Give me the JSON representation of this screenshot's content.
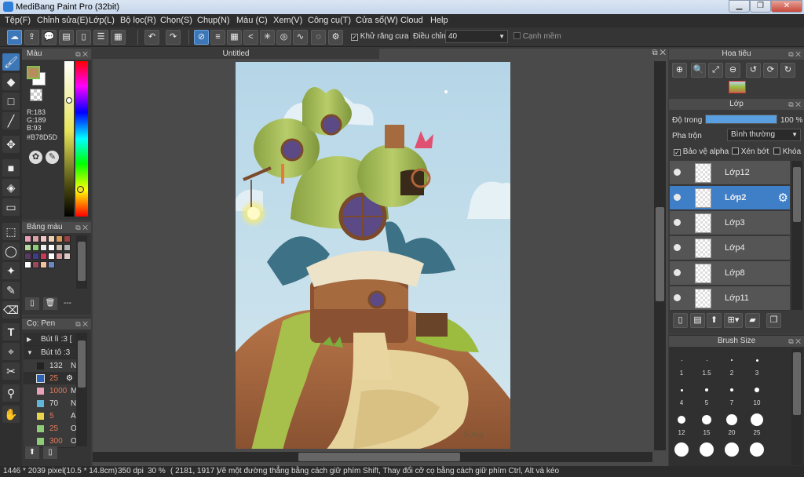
{
  "window": {
    "title": "MediBang Paint Pro (32bit)",
    "controls": [
      "▁",
      "❐",
      "✕"
    ]
  },
  "menu": [
    "Tệp(F)",
    "Chỉnh sửa(E)",
    "Lớp(L)",
    "Bộ lọc(R)",
    "Chọn(S)",
    "Chụp(N)",
    "Màu (C)",
    "Xem(V)",
    "Công cụ(T)",
    "Cửa sổ(W)",
    "Cloud",
    "Help"
  ],
  "toolbar": {
    "antialias_label": "Khử răng cưa",
    "antialias_checked": true,
    "adjust_label": "Điều chỉnh",
    "adjust_value": "40",
    "smooth_edge_label": "Cạnh mềm",
    "smooth_edge_checked": false
  },
  "color_panel": {
    "title": "Màu",
    "r": "R:183",
    "g": "G:189",
    "b": "B:93",
    "hex": "#B78D5D",
    "fg_color": "#b78d5d",
    "bg_color": "#ffffff"
  },
  "palette_panel": {
    "title": "Bảng màu",
    "more": "---",
    "swatches": [
      "#e8a0b8",
      "#d9a3a3",
      "#f4c7c7",
      "#f0d2b5",
      "#d79a58",
      "#9b4242",
      "#b6d69c",
      "#8fcc77",
      "#eeeeee",
      "#ffffff",
      "#c7bdaf",
      "#b0b0b0",
      "#5a3a63",
      "#3d3d8c",
      "#c93a5a",
      "#ffffff",
      "#d79a9a",
      "#e0c8c8",
      "#ffffff",
      "#9a4a5a",
      "#f4c0a0",
      "#6a8abf"
    ]
  },
  "pen_panel": {
    "title": "Cọ: Pen",
    "groups": [
      {
        "label": "Bút lì :3 [",
        "expanded": false
      },
      {
        "label": "Bút tô :3",
        "expanded": true
      }
    ],
    "brushes": [
      {
        "color": "#222222",
        "size": "132",
        "name": "N"
      },
      {
        "color": "#2a63b8",
        "size": "25",
        "name": "",
        "selected": true
      },
      {
        "color": "#e8a0b8",
        "size": "1000",
        "name": "M"
      },
      {
        "color": "#5fb6d9",
        "size": "70",
        "name": "N"
      },
      {
        "color": "#e8d54a",
        "size": "5",
        "name": "A"
      },
      {
        "color": "#8fcc77",
        "size": "25",
        "name": "O"
      },
      {
        "color": "#8fcc77",
        "size": "300",
        "name": "O"
      }
    ]
  },
  "document": {
    "tab": "Untitled",
    "signature": "Song"
  },
  "navigator": {
    "title": "Hoa tiêu"
  },
  "layer_panel": {
    "title": "Lớp",
    "opacity_label": "Độ trong",
    "opacity_value": "100 %",
    "opacity_fraction": 1.0,
    "blend_label": "Pha trộn",
    "blend_value": "Bình thường",
    "protect_alpha_label": "Bảo vệ alpha",
    "protect_alpha_checked": true,
    "clip_label": "Xén bớt",
    "clip_checked": false,
    "lock_label": "Khóa",
    "lock_checked": false,
    "layers": [
      {
        "name": "Lớp12",
        "selected": false
      },
      {
        "name": "Lớp2",
        "selected": true
      },
      {
        "name": "Lớp3",
        "selected": false
      },
      {
        "name": "Lớp4",
        "selected": false
      },
      {
        "name": "Lớp8",
        "selected": false
      },
      {
        "name": "Lớp11",
        "selected": false
      }
    ]
  },
  "brush_size_panel": {
    "title": "Brush Size",
    "sizes": [
      "1",
      "1.5",
      "2",
      "3",
      "4",
      "5",
      "7",
      "10",
      "12",
      "15",
      "20",
      "25",
      "",
      "",
      "",
      ""
    ]
  },
  "status": {
    "dimensions": "1446 * 2039 pixel",
    "physical": "(10.5 * 14.8cm)",
    "dpi": "350 dpi",
    "zoom": "30 %",
    "coords": "( 2181, 1917 )",
    "hint": "Vẽ một đường thẳng bằng cách giữ phím Shift, Thay đổi cỡ cọ bằng cách giữ phím Ctrl, Alt và kéo"
  }
}
